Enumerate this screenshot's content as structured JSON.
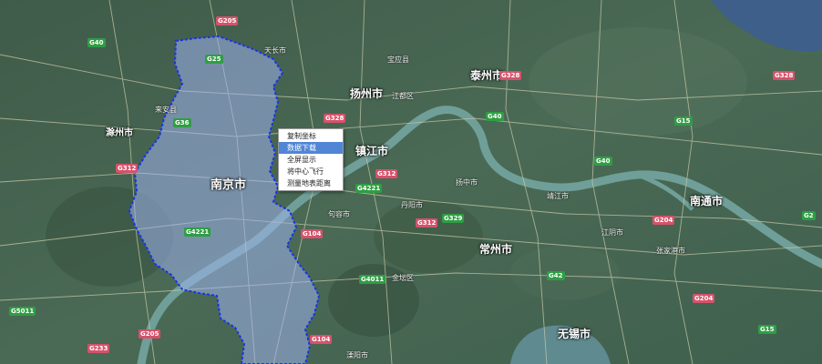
{
  "cities": [
    {
      "label": "南京市"
    },
    {
      "label": "扬州市"
    },
    {
      "label": "泰州市"
    },
    {
      "label": "镇江市"
    },
    {
      "label": "常州市"
    },
    {
      "label": "南通市"
    },
    {
      "label": "无锡市"
    },
    {
      "label": "滁州市"
    }
  ],
  "towns": [
    {
      "label": "宝应县"
    },
    {
      "label": "江都区"
    },
    {
      "label": "扬中市"
    },
    {
      "label": "丹阳市"
    },
    {
      "label": "金坛区"
    },
    {
      "label": "溧阳市"
    },
    {
      "label": "江阴市"
    },
    {
      "label": "张家港市"
    },
    {
      "label": "靖江市"
    },
    {
      "label": "来安县"
    },
    {
      "label": "天长市"
    },
    {
      "label": "句容市"
    }
  ],
  "road_labels": {
    "g40": "G40",
    "g42": "G42",
    "g2": "G2",
    "g15": "G15",
    "g25": "G25",
    "g36": "G36",
    "g104": "G104",
    "g4011": "G4011",
    "g5011": "G5011",
    "g328": "G328",
    "g205": "G205",
    "g312": "G312",
    "g204": "G204",
    "g233": "G233",
    "g329": "G329",
    "g4221": "G4221",
    "g4221b": "G4221"
  },
  "context_menu": {
    "items": [
      "复制坐标",
      "数据下载",
      "全屏显示",
      "将中心飞行",
      "测量地表距离"
    ],
    "active_index": 1
  },
  "colors": {
    "boundary": "#1a34e6",
    "region_fill": "#9fb3ee",
    "river": "#6f9f98",
    "national_road": "#2f9e44",
    "provincial_road": "#d6526b"
  }
}
